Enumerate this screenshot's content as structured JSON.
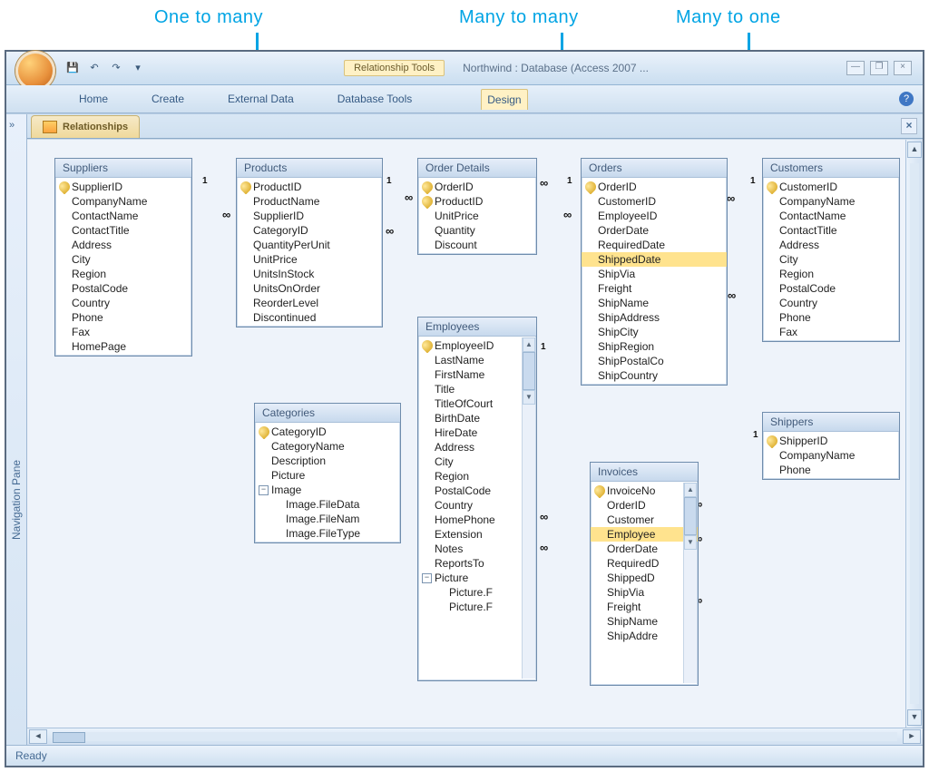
{
  "annotations": {
    "one_to_many": "One to many",
    "many_to_many": "Many to many",
    "many_to_one": "Many to one"
  },
  "titlebar": {
    "context_label": "Relationship Tools",
    "app_title": "Northwind : Database (Access 2007 ..."
  },
  "qat": {
    "save": "💾",
    "undo": "↶",
    "redo": "↷",
    "more": "▾"
  },
  "ribbon": {
    "home": "Home",
    "create": "Create",
    "external": "External Data",
    "dbtools": "Database Tools",
    "design": "Design"
  },
  "nav": {
    "chevrons": "»",
    "label": "Navigation Pane"
  },
  "doc_tab": "Relationships",
  "status": "Ready",
  "tables": {
    "suppliers": {
      "title": "Suppliers",
      "fields": [
        "SupplierID",
        "CompanyName",
        "ContactName",
        "ContactTitle",
        "Address",
        "City",
        "Region",
        "PostalCode",
        "Country",
        "Phone",
        "Fax",
        "HomePage"
      ],
      "pk": [
        0
      ]
    },
    "products": {
      "title": "Products",
      "fields": [
        "ProductID",
        "ProductName",
        "SupplierID",
        "CategoryID",
        "QuantityPerUnit",
        "UnitPrice",
        "UnitsInStock",
        "UnitsOnOrder",
        "ReorderLevel",
        "Discontinued"
      ],
      "pk": [
        0
      ]
    },
    "categories": {
      "title": "Categories",
      "fields": [
        "CategoryID",
        "CategoryName",
        "Description",
        "Picture",
        "Image",
        "Image.FileData",
        "Image.FileNam",
        "Image.FileType"
      ],
      "pk": [
        0
      ],
      "expand": [
        4
      ]
    },
    "orderdetails": {
      "title": "Order Details",
      "fields": [
        "OrderID",
        "ProductID",
        "UnitPrice",
        "Quantity",
        "Discount"
      ],
      "pk": [
        0,
        1
      ]
    },
    "employees": {
      "title": "Employees",
      "fields": [
        "EmployeeID",
        "LastName",
        "FirstName",
        "Title",
        "TitleOfCourt",
        "BirthDate",
        "HireDate",
        "Address",
        "City",
        "Region",
        "PostalCode",
        "Country",
        "HomePhone",
        "Extension",
        "Notes",
        "ReportsTo",
        "Picture",
        "Picture.F",
        "Picture.F"
      ],
      "pk": [
        0
      ],
      "expand": [
        16
      ]
    },
    "orders": {
      "title": "Orders",
      "fields": [
        "OrderID",
        "CustomerID",
        "EmployeeID",
        "OrderDate",
        "RequiredDate",
        "ShippedDate",
        "ShipVia",
        "Freight",
        "ShipName",
        "ShipAddress",
        "ShipCity",
        "ShipRegion",
        "ShipPostalCo",
        "ShipCountry"
      ],
      "pk": [
        0
      ],
      "highlight": [
        5
      ]
    },
    "invoices": {
      "title": "Invoices",
      "fields": [
        "InvoiceNo",
        "OrderID",
        "Customer",
        "Employee",
        "OrderDate",
        "RequiredD",
        "ShippedD",
        "ShipVia",
        "Freight",
        "ShipName",
        "ShipAddre"
      ],
      "pk": [
        0
      ],
      "highlight": [
        3
      ]
    },
    "customers": {
      "title": "Customers",
      "fields": [
        "CustomerID",
        "CompanyName",
        "ContactName",
        "ContactTitle",
        "Address",
        "City",
        "Region",
        "PostalCode",
        "Country",
        "Phone",
        "Fax"
      ],
      "pk": [
        0
      ]
    },
    "shippers": {
      "title": "Shippers",
      "fields": [
        "ShipperID",
        "CompanyName",
        "Phone"
      ],
      "pk": [
        0
      ]
    }
  },
  "symbols": {
    "one": "1",
    "many": "∞"
  }
}
